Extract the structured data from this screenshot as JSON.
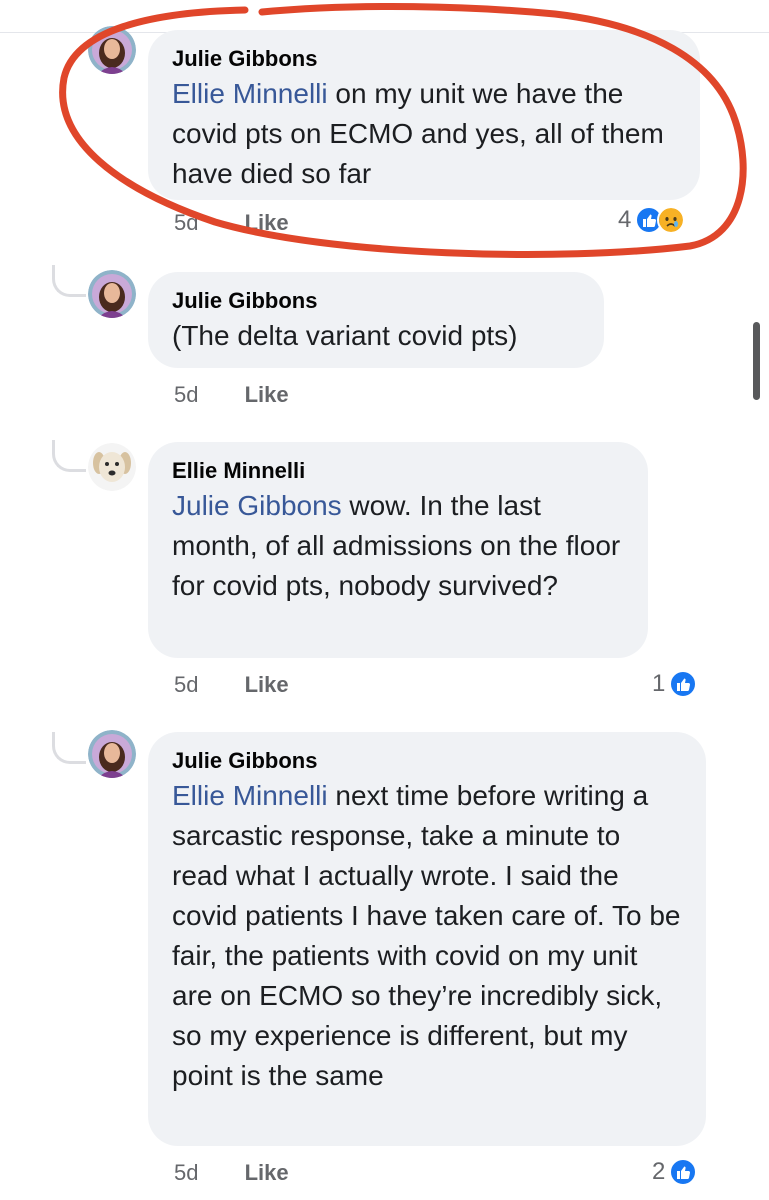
{
  "comments": [
    {
      "author": "Julie Gibbons",
      "mention": "Ellie Minnelli",
      "text": "  on my unit we have the covid pts on ECMO and yes, all of them have died so far",
      "time": "5d",
      "like_label": "Like",
      "reaction_count": "4",
      "reactions": [
        "like",
        "sad"
      ]
    },
    {
      "author": "Julie Gibbons",
      "mention": "",
      "text": "(The delta variant covid pts)",
      "time": "5d",
      "like_label": "Like"
    },
    {
      "author": "Ellie Minnelli",
      "mention": "Julie Gibbons",
      "text": " wow. In the last month, of all admissions on the floor for covid pts, nobody survived?",
      "time": "5d",
      "like_label": "Like",
      "reaction_count": "1",
      "reactions": [
        "like"
      ]
    },
    {
      "author": "Julie Gibbons",
      "mention": "Ellie Minnelli",
      "text": "  next time before writing a sarcastic response, take a minute to read what I actually wrote. I said the covid patients I have taken care of. To be fair, the patients with covid on my unit are on ECMO so they’re incredibly sick, so my experience is different, but my point is the same",
      "time": "5d",
      "like_label": "Like",
      "reaction_count": "2",
      "reactions": [
        "like"
      ]
    }
  ],
  "colors": {
    "bubble": "#f0f2f5",
    "mention": "#385898",
    "meta": "#65676b",
    "like_reaction": "#1877f2",
    "annotation_circle": "#e0462a"
  },
  "icons": {
    "like_reaction": "thumbs-up-icon",
    "sad_reaction": "sad-face-icon",
    "avatar_julie": "woman-portrait-avatar",
    "avatar_ellie": "dog-avatar"
  }
}
